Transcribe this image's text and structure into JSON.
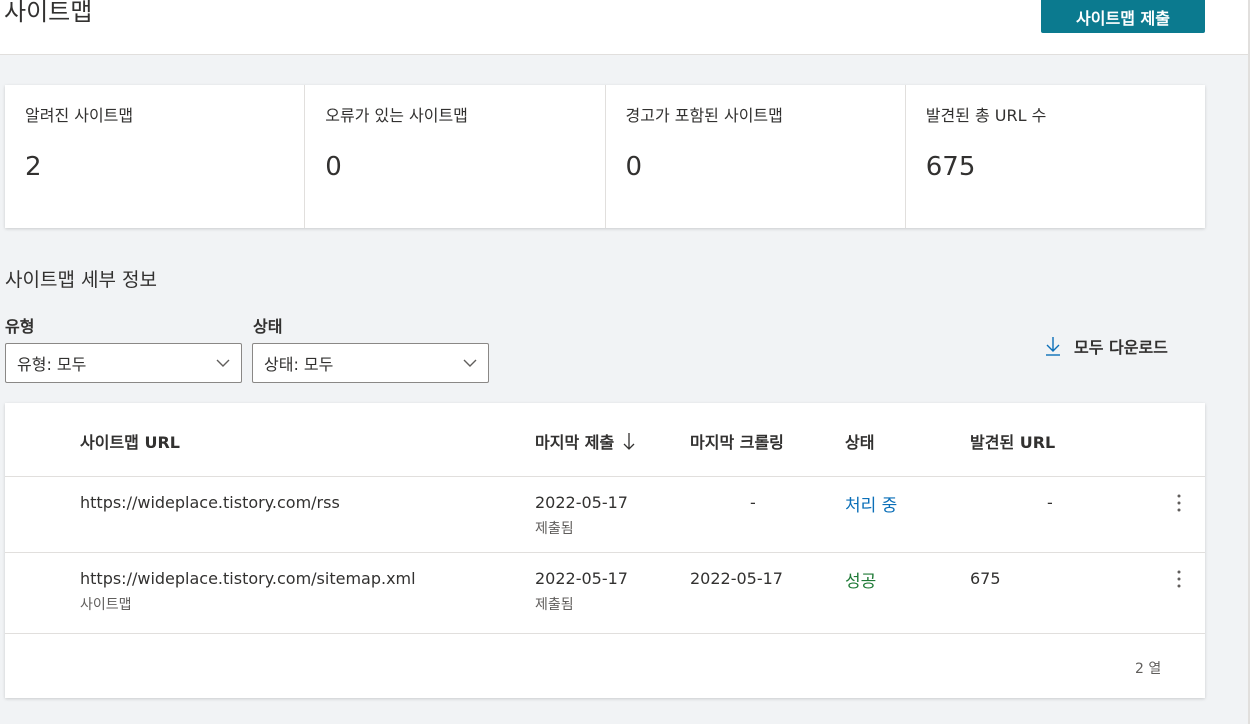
{
  "header": {
    "title": "사이트맵",
    "submit_label": "사이트맵 제출",
    "accent_color": "#0b7a8f"
  },
  "stats": [
    {
      "label": "알려진 사이트맵",
      "value": "2"
    },
    {
      "label": "오류가 있는 사이트맵",
      "value": "0"
    },
    {
      "label": "경고가 포함된 사이트맵",
      "value": "0"
    },
    {
      "label": "발견된 총 URL 수",
      "value": "675"
    }
  ],
  "details": {
    "title": "사이트맵 세부 정보",
    "filters": {
      "type_label": "유형",
      "type_value": "유형: 모두",
      "status_label": "상태",
      "status_value": "상태: 모두"
    },
    "download_label": "모두 다운로드",
    "download_icon": "arrow-down-icon"
  },
  "table": {
    "columns": {
      "url": "사이트맵 URL",
      "last_submitted": "마지막 제출",
      "last_crawled": "마지막 크롤링",
      "status": "상태",
      "discovered": "발견된 URL"
    },
    "sort_icon": "arrow-down-icon",
    "rows": [
      {
        "url": "https://wideplace.tistory.com/rss",
        "type": "",
        "submitted": "2022-05-17",
        "submitted_note": "제출됨",
        "crawled": "-",
        "status": "처리 중",
        "discovered": "-"
      },
      {
        "url": "https://wideplace.tistory.com/sitemap.xml",
        "type": "사이트맵",
        "submitted": "2022-05-17",
        "submitted_note": "제출됨",
        "crawled": "2022-05-17",
        "status": "성공",
        "discovered": "675"
      }
    ],
    "row_count": "2 열",
    "status_colors": {
      "processing": "#0b6fb8",
      "success": "#1f7a37"
    }
  }
}
